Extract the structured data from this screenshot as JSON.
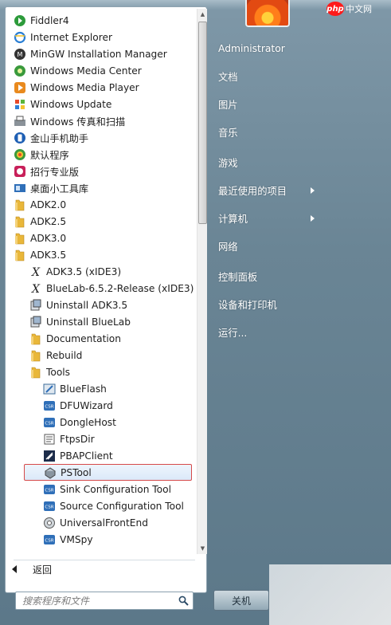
{
  "programs": [
    {
      "label": "Fiddler4",
      "icon": "fiddler-icon",
      "indent": 0
    },
    {
      "label": "Internet Explorer",
      "icon": "ie-icon",
      "indent": 0
    },
    {
      "label": "MinGW Installation Manager",
      "icon": "mingw-icon",
      "indent": 0
    },
    {
      "label": "Windows Media Center",
      "icon": "media-center-icon",
      "indent": 0
    },
    {
      "label": "Windows Media Player",
      "icon": "media-player-icon",
      "indent": 0
    },
    {
      "label": "Windows Update",
      "icon": "windows-update-icon",
      "indent": 0
    },
    {
      "label": "Windows 传真和扫描",
      "icon": "fax-scan-icon",
      "indent": 0
    },
    {
      "label": "金山手机助手",
      "icon": "phone-assistant-icon",
      "indent": 0
    },
    {
      "label": "默认程序",
      "icon": "default-programs-icon",
      "indent": 0
    },
    {
      "label": "招行专业版",
      "icon": "bank-icon",
      "indent": 0
    },
    {
      "label": "桌面小工具库",
      "icon": "gadgets-icon",
      "indent": 0
    },
    {
      "label": "ADK2.0",
      "icon": "folder-icon",
      "indent": 0
    },
    {
      "label": "ADK2.5",
      "icon": "folder-icon",
      "indent": 0
    },
    {
      "label": "ADK3.0",
      "icon": "folder-icon",
      "indent": 0
    },
    {
      "label": "ADK3.5",
      "icon": "folder-open-icon",
      "indent": 0
    },
    {
      "label": "ADK3.5 (xIDE3)",
      "icon": "xide-icon",
      "indent": 1
    },
    {
      "label": "BlueLab-6.5.2-Release (xIDE3)",
      "icon": "xide-icon",
      "indent": 1
    },
    {
      "label": "Uninstall ADK3.5",
      "icon": "uninstall-icon",
      "indent": 1
    },
    {
      "label": "Uninstall BlueLab",
      "icon": "uninstall-icon",
      "indent": 1
    },
    {
      "label": "Documentation",
      "icon": "folder-icon",
      "indent": 1
    },
    {
      "label": "Rebuild",
      "icon": "folder-icon",
      "indent": 1
    },
    {
      "label": "Tools",
      "icon": "folder-open-icon",
      "indent": 1
    },
    {
      "label": "BlueFlash",
      "icon": "blueflash-icon",
      "indent": 2
    },
    {
      "label": "DFUWizard",
      "icon": "csr-icon",
      "indent": 2
    },
    {
      "label": "DongleHost",
      "icon": "csr-icon",
      "indent": 2
    },
    {
      "label": "FtpsDir",
      "icon": "ftpsdir-icon",
      "indent": 2
    },
    {
      "label": "PBAPClient",
      "icon": "pbap-icon",
      "indent": 2
    },
    {
      "label": "PSTool",
      "icon": "pstool-icon",
      "indent": 2,
      "highlighted": true
    },
    {
      "label": "Sink Configuration Tool",
      "icon": "csr-icon",
      "indent": 2
    },
    {
      "label": "Source Configuration Tool",
      "icon": "csr-icon",
      "indent": 2
    },
    {
      "label": "UniversalFrontEnd",
      "icon": "ufe-icon",
      "indent": 2
    },
    {
      "label": "VMSpy",
      "icon": "csr-icon",
      "indent": 2
    }
  ],
  "back_label": "返回",
  "search": {
    "placeholder": "搜索程序和文件"
  },
  "right_menu": [
    {
      "label": "Administrator",
      "arrow": false
    },
    {
      "label": "文档",
      "arrow": false
    },
    {
      "label": "图片",
      "arrow": false
    },
    {
      "label": "音乐",
      "arrow": false
    },
    {
      "label": "游戏",
      "arrow": false
    },
    {
      "label": "最近使用的项目",
      "arrow": true
    },
    {
      "label": "计算机",
      "arrow": true
    },
    {
      "label": "网络",
      "arrow": false
    },
    {
      "label": "控制面板",
      "arrow": false
    },
    {
      "label": "设备和打印机",
      "arrow": false
    },
    {
      "label": "运行...",
      "arrow": false
    }
  ],
  "shutdown_label": "关机",
  "watermark": {
    "badge": "php",
    "text": "中文网"
  },
  "colors": {
    "highlight_border": "#d64a4a",
    "folder": "#e9b73a",
    "csr_blue": "#2f6fb8"
  }
}
